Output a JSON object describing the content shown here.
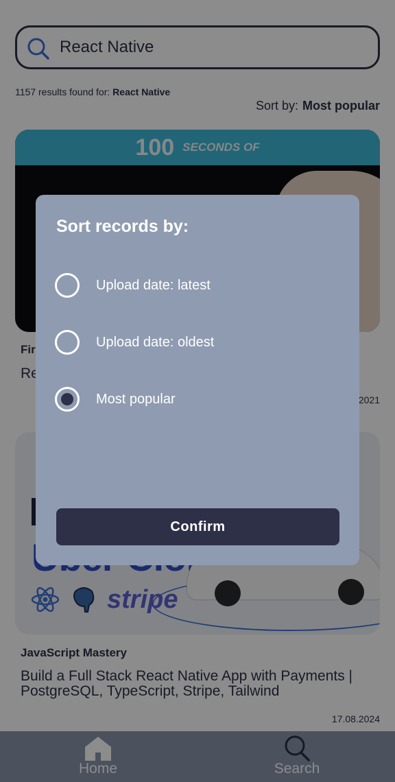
{
  "search": {
    "value": "React Native",
    "icon": "search-icon"
  },
  "results": {
    "count_text": "1157 results found for:",
    "query": "React Native"
  },
  "sort": {
    "label": "Sort by:",
    "value": "Most popular"
  },
  "cards": [
    {
      "thumbnail_text_big": "100",
      "thumbnail_text_small": "SECONDS OF",
      "channel": "Fir",
      "title": "Re",
      "date": "2021"
    },
    {
      "thumbnail_text_brand": "Uber Clone",
      "thumbnail_text_stripe": "stripe",
      "channel": "JavaScript Mastery",
      "title": "Build a Full Stack React Native App with Payments | PostgreSQL, TypeScript, Stripe, Tailwind",
      "date": "17.08.2024"
    }
  ],
  "tabbar": {
    "items": [
      {
        "label": "Home",
        "icon": "home-icon"
      },
      {
        "label": "Search",
        "icon": "search-icon"
      }
    ]
  },
  "modal": {
    "title": "Sort records by:",
    "options": [
      {
        "label": "Upload date: latest",
        "selected": false
      },
      {
        "label": "Upload date: oldest",
        "selected": false
      },
      {
        "label": "Most popular",
        "selected": true
      }
    ],
    "confirm_label": "Confirm"
  },
  "colors": {
    "primary": "#2d3047",
    "modal_bg": "#8f9bb0",
    "tabbar_bg": "#8a94ab",
    "overlay": "rgba(0,0,0,0.45)"
  }
}
